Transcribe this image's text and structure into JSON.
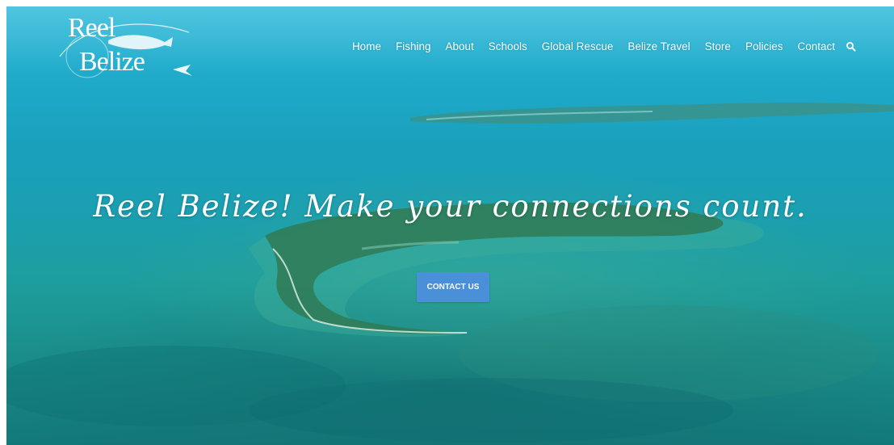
{
  "brand": {
    "logo_line1": "Reel",
    "logo_line2": "Belize"
  },
  "nav": {
    "items": [
      {
        "label": "Home"
      },
      {
        "label": "Fishing"
      },
      {
        "label": "About"
      },
      {
        "label": "Schools"
      },
      {
        "label": "Global Rescue"
      },
      {
        "label": "Belize Travel"
      },
      {
        "label": "Store"
      },
      {
        "label": "Policies"
      },
      {
        "label": "Contact"
      }
    ],
    "search_icon": "search-icon"
  },
  "hero": {
    "tagline": "Reel Belize! Make your connections count.",
    "cta_label": "CONTACT US"
  },
  "colors": {
    "cta_background": "#4a90d9",
    "nav_text": "#ffffff"
  }
}
